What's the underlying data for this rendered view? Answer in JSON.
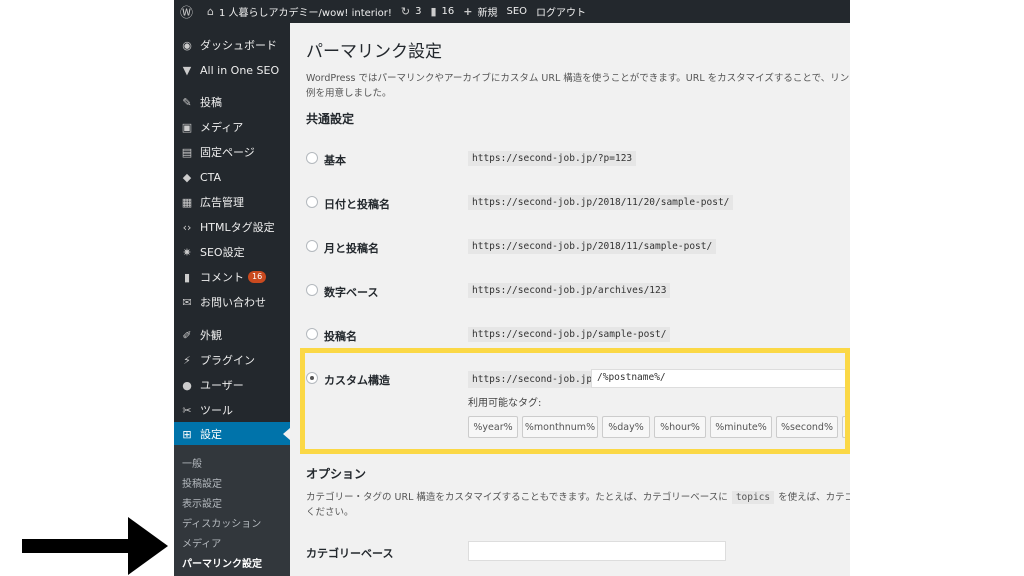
{
  "adminbar": {
    "site_name": "1 人暮らしアカデミー/wow! interior!",
    "updates_count": "3",
    "comments_count": "16",
    "new_label": "新規",
    "seo_label": "SEO",
    "logout_label": "ログアウト"
  },
  "sidebar": {
    "items": [
      {
        "label": "ダッシュボード",
        "icon": "dashboard-icon"
      },
      {
        "label": "All in One SEO",
        "icon": "aioseo-icon"
      },
      {
        "label": "投稿",
        "icon": "pin-icon"
      },
      {
        "label": "メディア",
        "icon": "media-icon"
      },
      {
        "label": "固定ページ",
        "icon": "page-icon"
      },
      {
        "label": "CTA",
        "icon": "tag-icon"
      },
      {
        "label": "広告管理",
        "icon": "ad-icon"
      },
      {
        "label": "HTMLタグ設定",
        "icon": "code-icon"
      },
      {
        "label": "SEO設定",
        "icon": "gear-icon"
      },
      {
        "label": "コメント",
        "icon": "comment-icon",
        "badge": "16"
      },
      {
        "label": "お問い合わせ",
        "icon": "mail-icon"
      },
      {
        "label": "外観",
        "icon": "brush-icon"
      },
      {
        "label": "プラグイン",
        "icon": "plugin-icon"
      },
      {
        "label": "ユーザー",
        "icon": "user-icon"
      },
      {
        "label": "ツール",
        "icon": "wrench-icon"
      },
      {
        "label": "設定",
        "icon": "settings-icon"
      }
    ],
    "submenu": [
      "一般",
      "投稿設定",
      "表示設定",
      "ディスカッション",
      "メディア",
      "パーマリンク設定"
    ]
  },
  "page": {
    "title": "パーマリンク設定",
    "description_line1": "WordPress ではパーマリンクやアーカイブにカスタム URL 構造を使うことができます。URL をカスタマイズすることで、リンク",
    "description_line2": "例を用意しました。",
    "common_settings_title": "共通設定",
    "options": [
      {
        "label": "基本",
        "example": "https://second-job.jp/?p=123"
      },
      {
        "label": "日付と投稿名",
        "example": "https://second-job.jp/2018/11/20/sample-post/"
      },
      {
        "label": "月と投稿名",
        "example": "https://second-job.jp/2018/11/sample-post/"
      },
      {
        "label": "数字ベース",
        "example": "https://second-job.jp/archives/123"
      },
      {
        "label": "投稿名",
        "example": "https://second-job.jp/sample-post/"
      }
    ],
    "custom": {
      "label": "カスタム構造",
      "base": "https://second-job.jp",
      "value": "/%postname%/",
      "tags_label": "利用可能なタグ:",
      "tags": [
        "%year%",
        "%monthnum%",
        "%day%",
        "%hour%",
        "%minute%",
        "%second%"
      ]
    },
    "options_title": "オプション",
    "options_desc_1": "カテゴリー・タグの URL 構造をカスタマイズすることもできます。たとえば、カテゴリーベースに",
    "options_code": "topics",
    "options_desc_2": "を使えば、カテゴ",
    "options_desc_3": "ください。",
    "category_base_label": "カテゴリーベース"
  },
  "colors": {
    "sidebar_bg": "#23282d",
    "accent": "#0073aa",
    "highlight": "#fbd846"
  }
}
